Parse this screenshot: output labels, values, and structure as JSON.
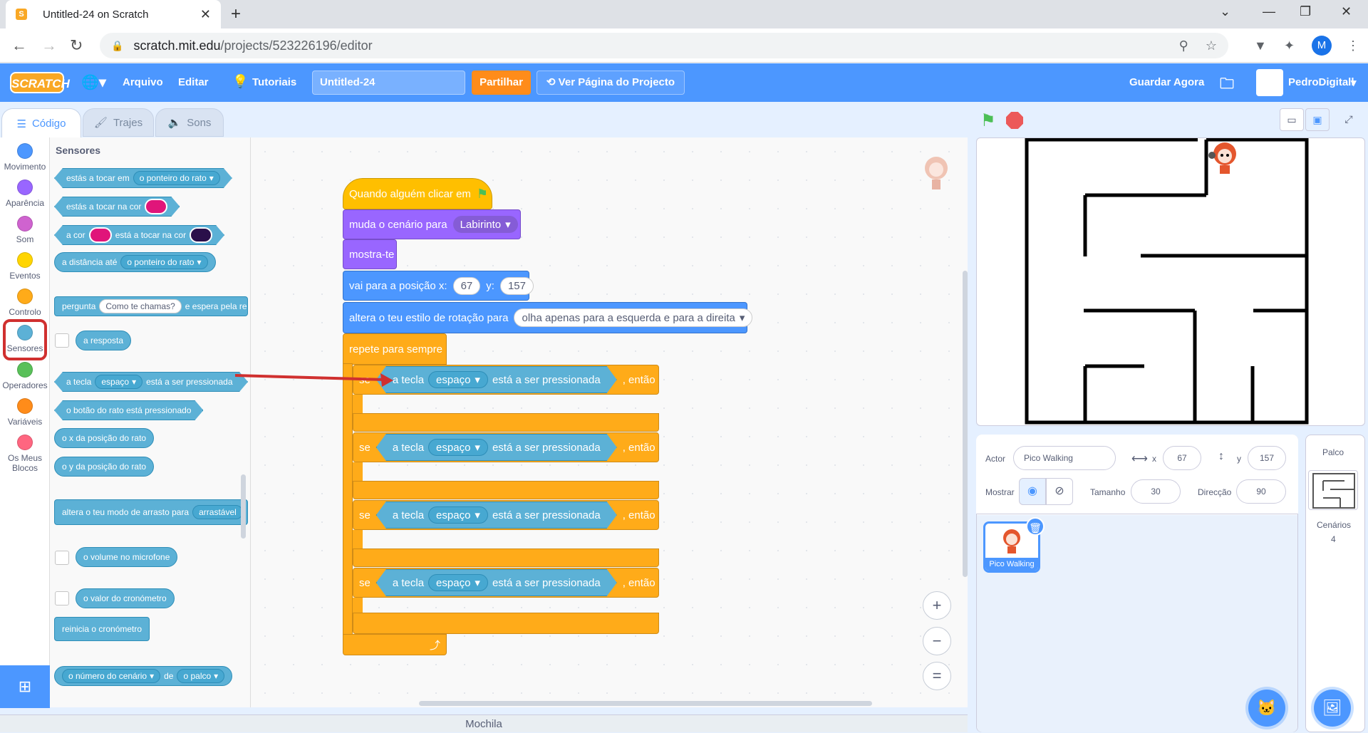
{
  "browser": {
    "tab_title": "Untitled-24 on Scratch",
    "url_host": "scratch.mit.edu",
    "url_path": "/projects/523226196/editor",
    "profile_initial": "M"
  },
  "menu": {
    "logo": "SCRATCH",
    "file": "Arquivo",
    "edit": "Editar",
    "tutorials": "Tutoriais",
    "project_title": "Untitled-24",
    "share": "Partilhar",
    "see_project_page": "Ver Página do Projecto",
    "save_now": "Guardar Agora",
    "username": "PedroDigitall"
  },
  "editor_tabs": {
    "code": "Código",
    "costumes": "Trajes",
    "sounds": "Sons"
  },
  "categories": [
    {
      "label": "Movimento",
      "color": "#4c97ff"
    },
    {
      "label": "Aparência",
      "color": "#9966ff"
    },
    {
      "label": "Som",
      "color": "#cf63cf"
    },
    {
      "label": "Eventos",
      "color": "#ffd500"
    },
    {
      "label": "Controlo",
      "color": "#ffab19"
    },
    {
      "label": "Sensores",
      "color": "#5cb1d6"
    },
    {
      "label": "Operadores",
      "color": "#59c059"
    },
    {
      "label": "Variáveis",
      "color": "#ff8c1a"
    },
    {
      "label": "Os Meus Blocos",
      "color": "#ff6680"
    }
  ],
  "palette": {
    "title": "Sensores",
    "touching": "estás a tocar em",
    "touching_opt": "o ponteiro do rato",
    "touching_color": "estás a tocar na cor",
    "color_a": "a cor",
    "color_touching": "está a tocar na cor",
    "distance": "a distância até",
    "distance_opt": "o ponteiro do rato",
    "ask": "pergunta",
    "ask_default": "Como te chamas?",
    "ask_wait": "e espera pela re",
    "answer": "a resposta",
    "key_a": "a tecla",
    "key_opt": "espaço",
    "key_pressed": "está a ser pressionada",
    "mouse_down": "o botão do rato está pressionado",
    "mouse_x": "o x da posição do rato",
    "mouse_y": "o y da posição do rato",
    "drag_mode": "altera o teu modo de arrasto para",
    "drag_opt": "arrastável",
    "loudness": "o volume no microfone",
    "timer": "o valor do cronómetro",
    "reset_timer": "reinicia o cronómetro",
    "backdrop_num": "o número do cenário",
    "of": "de",
    "stage_opt": "o palco"
  },
  "script": {
    "when_flag": "Quando alguém clicar em",
    "switch_backdrop": "muda o cenário para",
    "backdrop_opt": "Labirinto",
    "show": "mostra-te",
    "goto": "vai para a posição x:",
    "x_val": "67",
    "y_label": "y:",
    "y_val": "157",
    "rotation": "altera o teu estilo de rotação para",
    "rotation_opt": "olha apenas para a esquerda e para a direita",
    "forever": "repete para sempre",
    "if": "se",
    "then": ", então",
    "key_a": "a tecla",
    "key_opt": "espaço",
    "key_pressed": "está a ser pressionada"
  },
  "backpack": "Mochila",
  "sprite_info": {
    "actor_label": "Actor",
    "actor_name": "Pico Walking",
    "x_label": "x",
    "x_val": "67",
    "y_label": "y",
    "y_val": "157",
    "show_label": "Mostrar",
    "size_label": "Tamanho",
    "size_val": "30",
    "direction_label": "Direcção",
    "direction_val": "90"
  },
  "sprites": [
    {
      "name": "Pico Walking"
    }
  ],
  "stage_panel": {
    "title": "Palco",
    "backdrops_label": "Cenários",
    "backdrops_count": "4"
  },
  "colors": {
    "scratch_blue": "#4c97ff",
    "highlight_red": "#d0302f"
  }
}
